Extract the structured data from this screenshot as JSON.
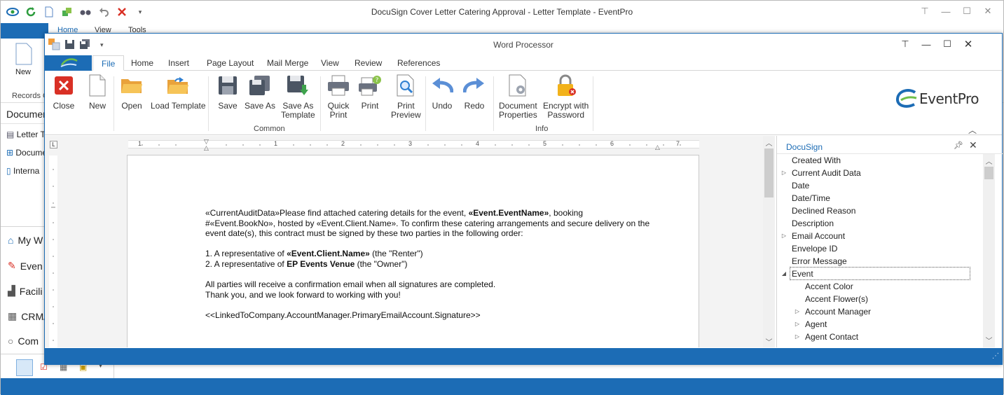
{
  "main_window": {
    "title": "DocuSign Cover Letter Catering Approval - Letter Template - EventPro",
    "tabs": [
      "Home",
      "View",
      "Tools"
    ],
    "new_label": "New",
    "records_label": "Records C",
    "section_header": "Documer",
    "left_items": [
      "Letter T",
      "Docume",
      "Interna"
    ],
    "nav_items": [
      "My W",
      "Even",
      "Facili",
      "CRM/",
      "Com"
    ]
  },
  "word_processor": {
    "title": "Word Processor",
    "tabs": [
      "File",
      "Home",
      "Insert",
      "Page Layout",
      "Mail Merge",
      "View",
      "Review",
      "References"
    ],
    "active_tab": "File",
    "ribbon": {
      "buttons": {
        "close": "Close",
        "new": "New",
        "open": "Open",
        "load_template": "Load Template",
        "save": "Save",
        "save_as": "Save As",
        "save_as_template_1": "Save As",
        "save_as_template_2": "Template",
        "quick_print_1": "Quick",
        "quick_print_2": "Print",
        "print": "Print",
        "print_preview_1": "Print",
        "print_preview_2": "Preview",
        "undo": "Undo",
        "redo": "Redo",
        "doc_props_1": "Document",
        "doc_props_2": "Properties",
        "encrypt_1": "Encrypt with",
        "encrypt_2": "Password"
      },
      "groups": {
        "common": "Common",
        "info": "Info"
      }
    },
    "logo_text": "EventPro",
    "ruler_numbers": [
      "1",
      "1",
      "2",
      "3",
      "4",
      "5",
      "6",
      "7"
    ],
    "document": {
      "p1_a": "«CurrentAuditData»Please find attached catering details for the event, ",
      "p1_b": "«Event.EventName»",
      "p1_c": ", booking",
      "p2": "#«Event.BookNo», hosted by «Event.Client.Name». To confirm these catering arrangements and secure delivery on the",
      "p3": "event date(s), this contract must be signed by these two parties in the following order:",
      "li1_a": "1.  A representative of ",
      "li1_b": "«Event.Client.Name»",
      "li1_c": " (the \"Renter\")",
      "li2_a": "2.  A representative of ",
      "li2_b": "EP Events Venue",
      "li2_c": " (the \"Owner\")",
      "p4": "All parties will receive a confirmation email when all signatures are completed.",
      "p5": "Thank you, and we look forward to working with you!",
      "p6": "<<LinkedToCompany.AccountManager.PrimaryEmailAccount.Signature>>"
    },
    "docusign_panel": {
      "title": "DocuSign",
      "fields": [
        {
          "label": "Created With",
          "level": 0,
          "expander": "none"
        },
        {
          "label": "Current Audit Data",
          "level": 0,
          "expander": "collapsed"
        },
        {
          "label": "Date",
          "level": 0,
          "expander": "none"
        },
        {
          "label": "Date/Time",
          "level": 0,
          "expander": "none"
        },
        {
          "label": "Declined Reason",
          "level": 0,
          "expander": "none"
        },
        {
          "label": "Description",
          "level": 0,
          "expander": "none"
        },
        {
          "label": "Email Account",
          "level": 0,
          "expander": "collapsed"
        },
        {
          "label": "Envelope ID",
          "level": 0,
          "expander": "none"
        },
        {
          "label": "Error Message",
          "level": 0,
          "expander": "none"
        },
        {
          "label": "Event",
          "level": 0,
          "expander": "expanded"
        },
        {
          "label": "Accent Color",
          "level": 1,
          "expander": "none"
        },
        {
          "label": "Accent Flower(s)",
          "level": 1,
          "expander": "none"
        },
        {
          "label": "Account Manager",
          "level": 1,
          "expander": "collapsed"
        },
        {
          "label": "Agent",
          "level": 1,
          "expander": "collapsed"
        },
        {
          "label": "Agent Contact",
          "level": 1,
          "expander": "collapsed"
        }
      ],
      "selected": "Event"
    }
  },
  "colors": {
    "accent": "#1c6cb5",
    "close_red": "#d93025",
    "green": "#4caf50"
  }
}
